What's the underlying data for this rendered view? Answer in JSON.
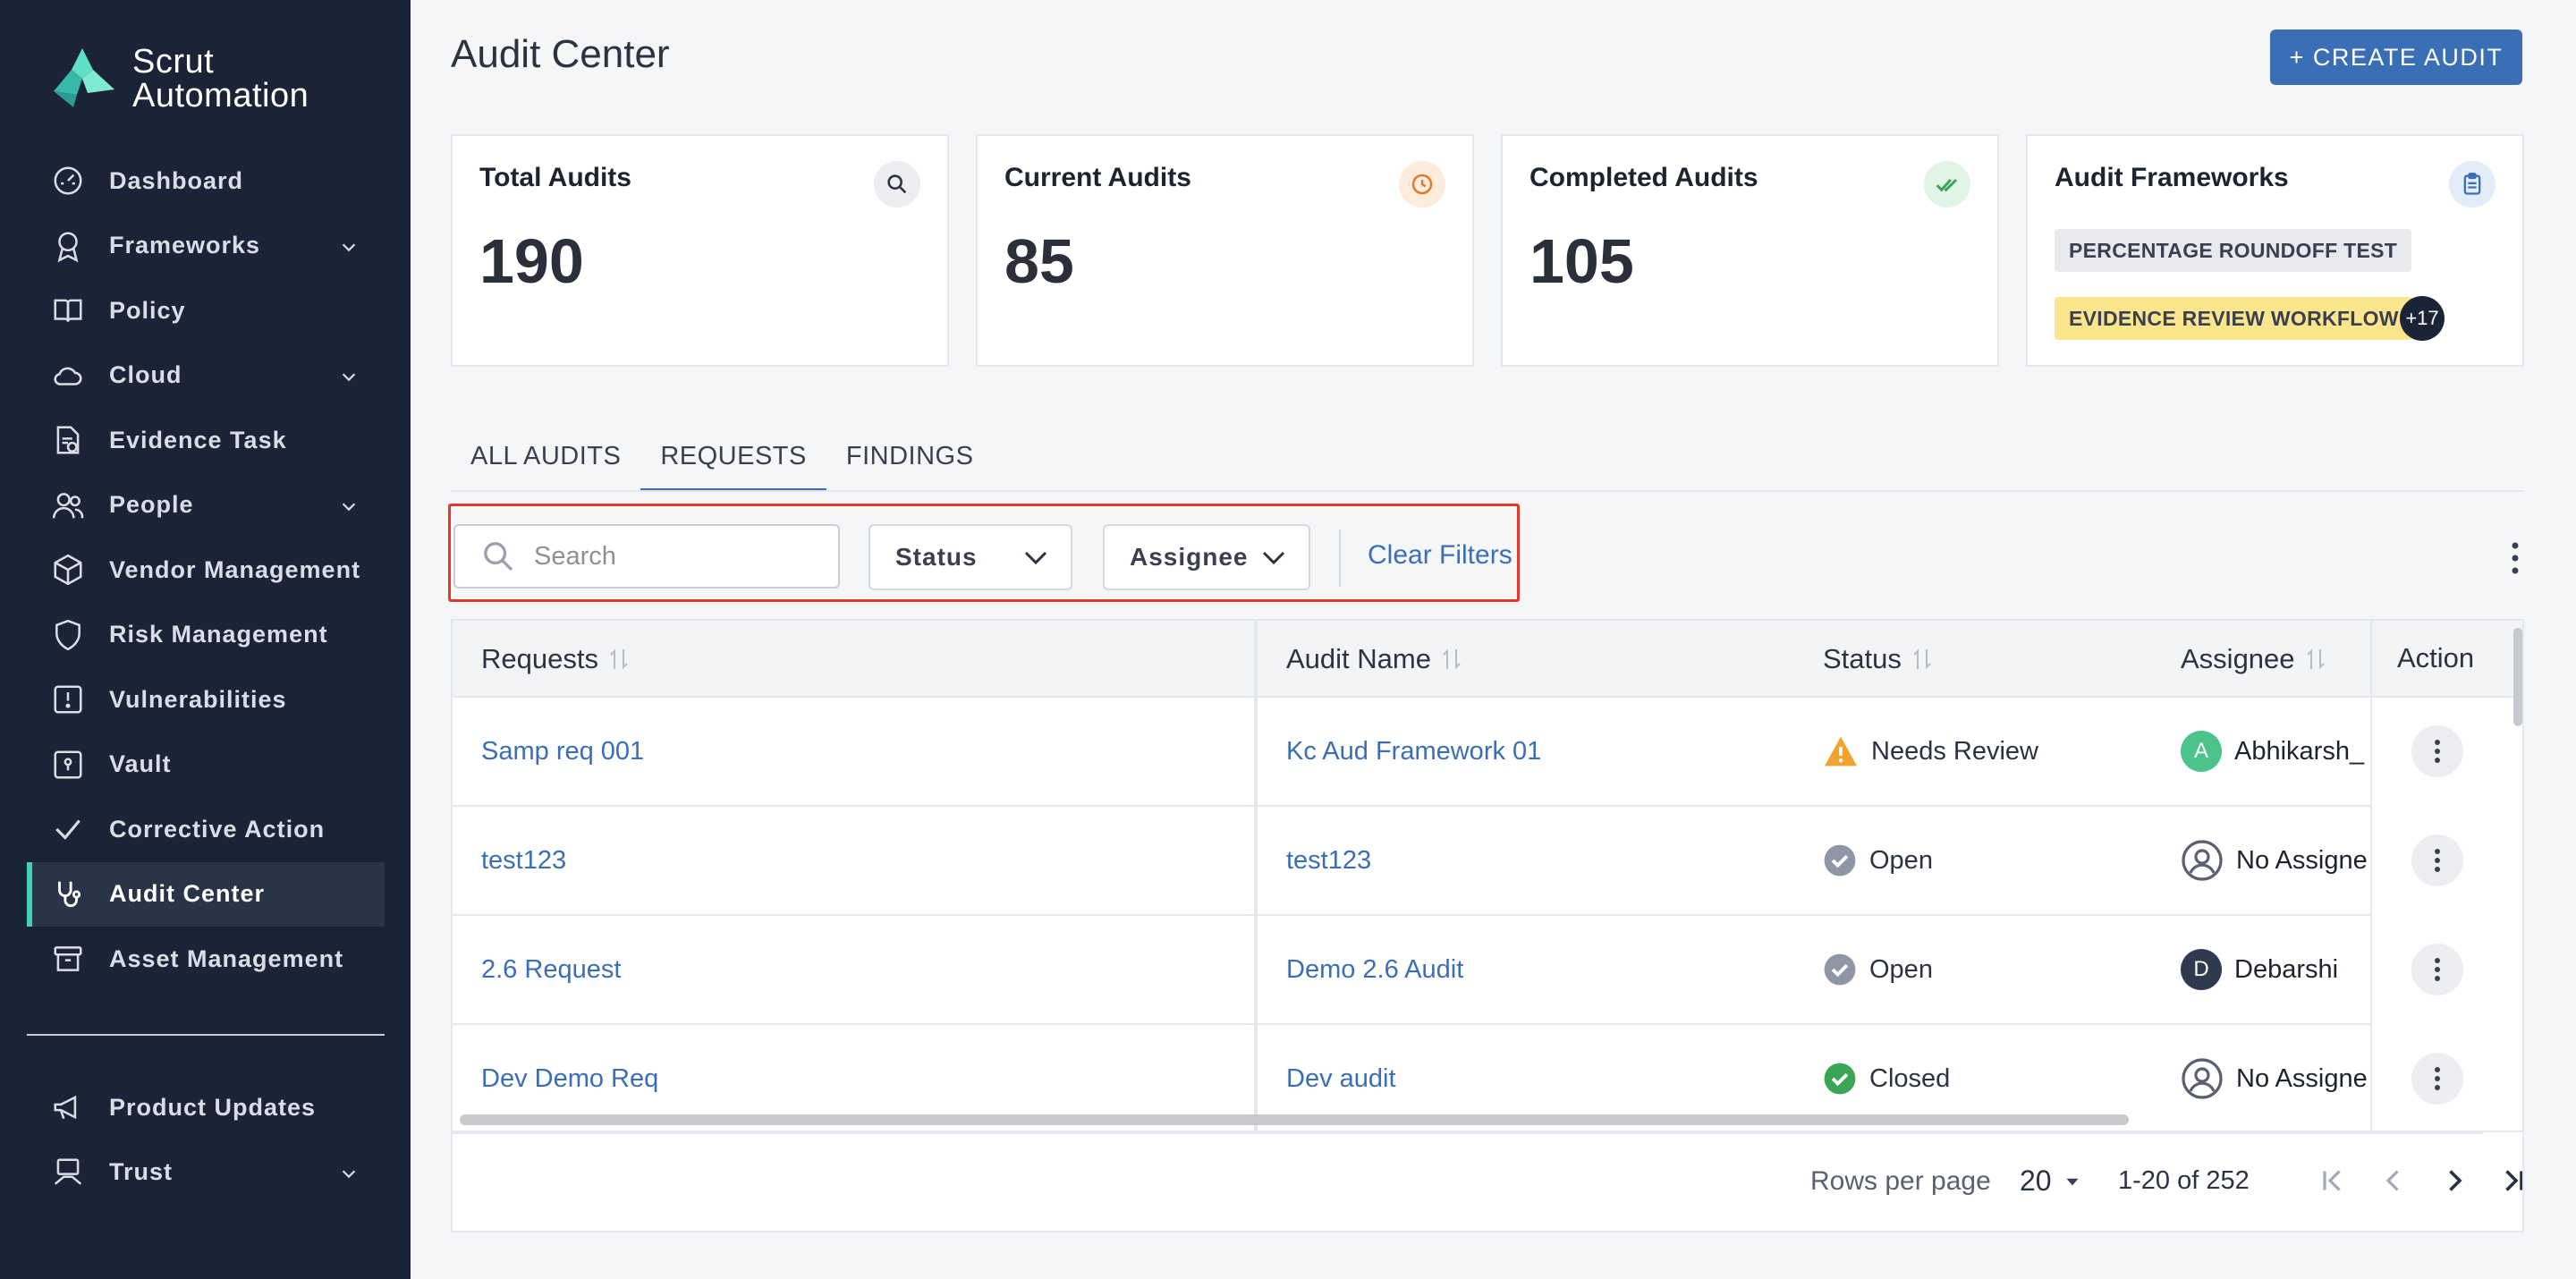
{
  "brand": {
    "line1": "Scrut",
    "line2": "Automation",
    "accent": "#3fd0b5"
  },
  "sidebar": {
    "items": [
      {
        "label": "Dashboard",
        "icon": "dashboard-gauge-icon",
        "expandable": false,
        "active": false
      },
      {
        "label": "Frameworks",
        "icon": "award-ribbon-icon",
        "expandable": true,
        "active": false
      },
      {
        "label": "Policy",
        "icon": "book-icon",
        "expandable": false,
        "active": false
      },
      {
        "label": "Cloud",
        "icon": "cloud-icon",
        "expandable": true,
        "active": false
      },
      {
        "label": "Evidence Task",
        "icon": "document-check-icon",
        "expandable": false,
        "active": false
      },
      {
        "label": "People",
        "icon": "people-icon",
        "expandable": true,
        "active": false
      },
      {
        "label": "Vendor Management",
        "icon": "cube-icon",
        "expandable": false,
        "active": false
      },
      {
        "label": "Risk Management",
        "icon": "shield-icon",
        "expandable": false,
        "active": false
      },
      {
        "label": "Vulnerabilities",
        "icon": "alert-square-icon",
        "expandable": false,
        "active": false
      },
      {
        "label": "Vault",
        "icon": "vault-icon",
        "expandable": false,
        "active": false
      },
      {
        "label": "Corrective Action",
        "icon": "checkmark-icon",
        "expandable": false,
        "active": false
      },
      {
        "label": "Audit Center",
        "icon": "stethoscope-icon",
        "expandable": false,
        "active": true
      },
      {
        "label": "Asset Management",
        "icon": "archive-box-icon",
        "expandable": false,
        "active": false
      }
    ],
    "bottom_items": [
      {
        "label": "Product Updates",
        "icon": "megaphone-icon",
        "expandable": false
      },
      {
        "label": "Trust",
        "icon": "trust-hand-icon",
        "expandable": true
      }
    ]
  },
  "header": {
    "title": "Audit Center",
    "create_button": "+ CREATE AUDIT"
  },
  "stats": [
    {
      "title": "Total Audits",
      "value": "190",
      "icon": "search-icon"
    },
    {
      "title": "Current Audits",
      "value": "85",
      "icon": "clock-icon"
    },
    {
      "title": "Completed Audits",
      "value": "105",
      "icon": "double-check-icon"
    }
  ],
  "frameworks_card": {
    "title": "Audit Frameworks",
    "icon": "clipboard-icon",
    "chips": [
      "PERCENTAGE ROUNDOFF TEST",
      "EVIDENCE REVIEW WORKFLOW"
    ],
    "more": "+17"
  },
  "tabs": [
    "ALL AUDITS",
    "REQUESTS",
    "FINDINGS"
  ],
  "active_tab": "REQUESTS",
  "filters": {
    "search_placeholder": "Search",
    "status_label": "Status",
    "assignee_label": "Assignee",
    "clear_label": "Clear Filters"
  },
  "table": {
    "columns": [
      "Requests",
      "Audit Name",
      "Status",
      "Assignee",
      "Action"
    ],
    "rows": [
      {
        "request": "Samp req 001",
        "audit": "Kc Aud Framework 01",
        "status": "Needs Review",
        "status_icon": "warning-icon",
        "assignee": "Abhikarsh_",
        "avatar": "A",
        "avatar_color": "#4cc38a"
      },
      {
        "request": "test123",
        "audit": "test123",
        "status": "Open",
        "status_icon": "check-circle-gray-icon",
        "assignee": "No Assigne",
        "avatar": "",
        "avatar_color": ""
      },
      {
        "request": "2.6 Request",
        "audit": "Demo 2.6 Audit",
        "status": "Open",
        "status_icon": "check-circle-gray-icon",
        "assignee": "Debarshi",
        "avatar": "D",
        "avatar_color": "#2f3a4f"
      },
      {
        "request": "Dev Demo Req",
        "audit": "Dev audit",
        "status": "Closed",
        "status_icon": "check-circle-green-icon",
        "assignee": "No Assigne",
        "avatar": "",
        "avatar_color": ""
      }
    ]
  },
  "pagination": {
    "rows_per_page_label": "Rows per page",
    "rows_per_page": "20",
    "range": "1-20 of 252"
  }
}
